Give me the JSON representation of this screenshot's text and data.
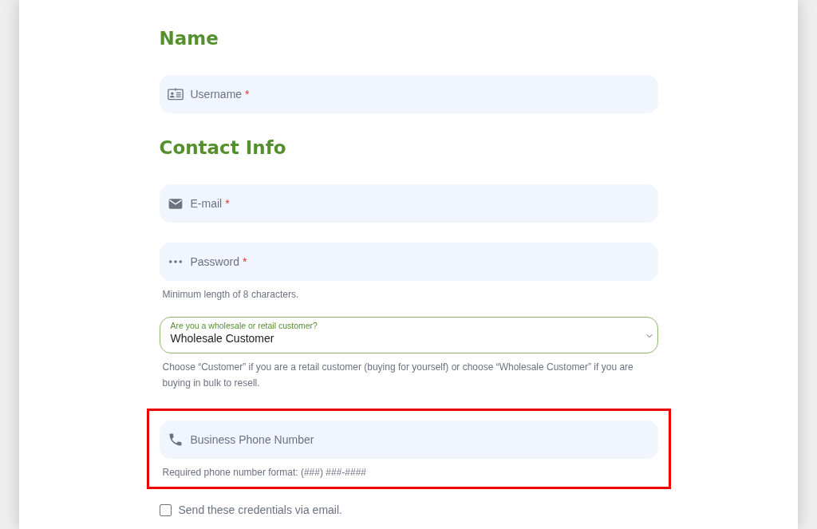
{
  "items": [
    {
      "kind": "heading",
      "text": "Name"
    },
    {
      "kind": "id-field",
      "placeholder": "Username",
      "required_mark": "*",
      "highlighted": false
    },
    {
      "kind": "heading",
      "text": "Contact Info"
    },
    {
      "kind": "email-field",
      "placeholder": "E-mail",
      "required_mark": "*",
      "highlighted": false
    },
    {
      "kind": "password-field",
      "placeholder": "Password",
      "required_mark": "*",
      "help": "Minimum length of 8 characters.",
      "highlighted": false
    },
    {
      "kind": "select",
      "label": "Are you a wholesale or retail customer?",
      "value": "Wholesale Customer",
      "help": "Choose “Customer” if you are a retail customer (buying for yourself) or choose “Wholesale Customer” if you are buying in bulk to resell."
    },
    {
      "kind": "phone-field",
      "placeholder": "Business Phone Number",
      "help": "Required phone number format: (###) ###-####",
      "highlighted": true
    },
    {
      "kind": "checkbox",
      "label": "Send these credentials via email.",
      "checked": false
    }
  ]
}
